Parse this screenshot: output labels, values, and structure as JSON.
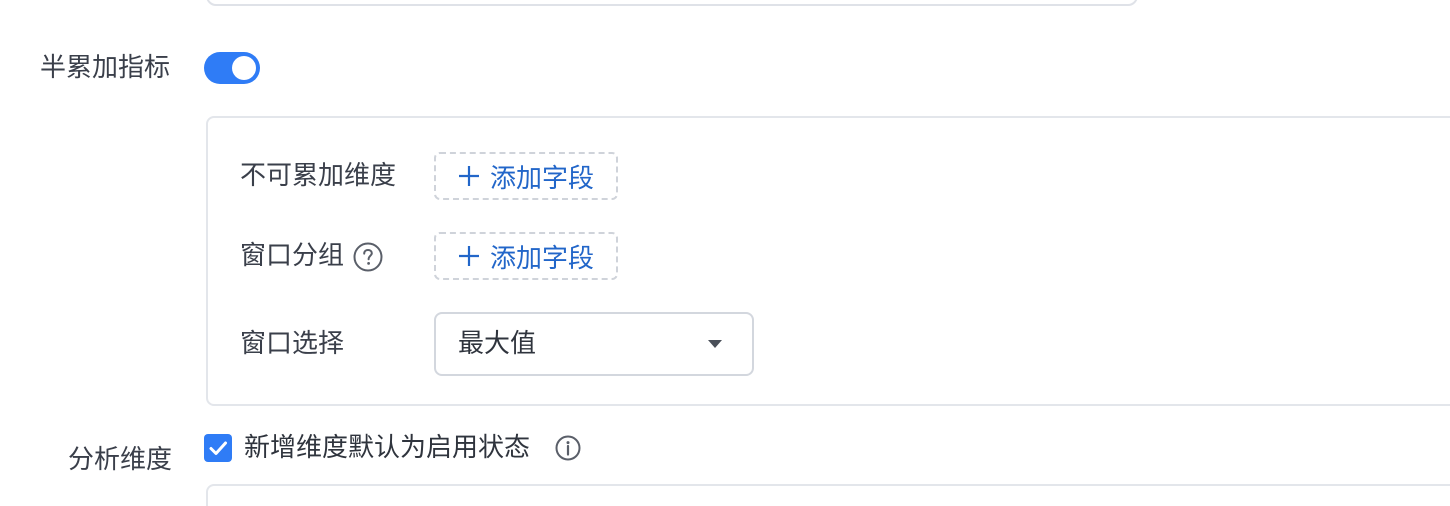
{
  "semi_additive": {
    "label": "半累加指标",
    "enabled": true,
    "non_additive_dimensions": {
      "label": "不可累加维度",
      "add_button_label": "添加字段"
    },
    "window_grouping": {
      "label": "窗口分组",
      "help_icon": "question-circle-icon",
      "add_button_label": "添加字段"
    },
    "window_selection": {
      "label": "窗口选择",
      "selected_value": "最大值",
      "caret_icon": "caret-down-icon"
    }
  },
  "analysis_dimensions": {
    "label": "分析维度",
    "default_enable_checkbox": {
      "label": "新增维度默认为启用状态",
      "checked": true,
      "info_icon": "info-circle-icon"
    }
  },
  "colors": {
    "accent": "#2f7cf6",
    "link": "#2266c9",
    "text": "#3a3f4a",
    "border": "#e3e6eb"
  }
}
